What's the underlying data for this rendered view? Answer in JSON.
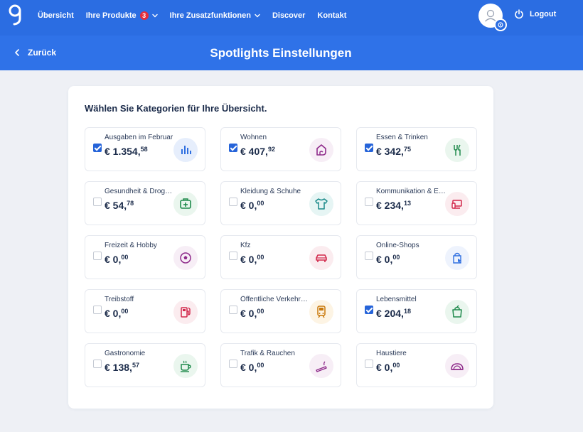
{
  "header": {
    "nav": [
      {
        "label": "Übersicht"
      },
      {
        "label": "Ihre Produkte",
        "badge": "3"
      },
      {
        "label": "Ihre Zusatzfunktionen"
      },
      {
        "label": "Discover"
      },
      {
        "label": "Kontakt"
      }
    ],
    "logout_label": "Logout"
  },
  "subheader": {
    "back_label": "Zurück",
    "title": "Spotlights Einstellungen"
  },
  "main": {
    "heading": "Wählen Sie Kategorien für Ihre Übersicht.",
    "categories": [
      {
        "title": "Ausgaben im Februar",
        "euros": "€ 1.354,",
        "cents": "58",
        "checked": true,
        "icon": "bar-chart-icon",
        "color": "#2f6fe0",
        "bg": "#e6eefc"
      },
      {
        "title": "Wohnen",
        "euros": "€ 407,",
        "cents": "92",
        "checked": true,
        "icon": "home-icon",
        "color": "#8e2a8a",
        "bg": "#f7eef6"
      },
      {
        "title": "Essen & Trinken",
        "euros": "€ 342,",
        "cents": "75",
        "checked": true,
        "icon": "cutlery-icon",
        "color": "#1f8a4c",
        "bg": "#eaf6ee"
      },
      {
        "title": "Gesundheit & Drogerie",
        "euros": "€ 54,",
        "cents": "78",
        "checked": false,
        "icon": "first-aid-icon",
        "color": "#1f8a4c",
        "bg": "#eaf6ee"
      },
      {
        "title": "Kleidung & Schuhe",
        "euros": "€ 0,",
        "cents": "00",
        "checked": false,
        "icon": "tshirt-icon",
        "color": "#1a8a8a",
        "bg": "#e6f5f4"
      },
      {
        "title": "Kommunikation & Elektronik",
        "euros": "€ 234,",
        "cents": "13",
        "checked": false,
        "icon": "devices-icon",
        "color": "#d1264a",
        "bg": "#fbecef"
      },
      {
        "title": "Freizeit & Hobby",
        "euros": "€ 0,",
        "cents": "00",
        "checked": false,
        "icon": "ball-icon",
        "color": "#8e2a8a",
        "bg": "#f7eef6"
      },
      {
        "title": "Kfz",
        "euros": "€ 0,",
        "cents": "00",
        "checked": false,
        "icon": "car-icon",
        "color": "#d1264a",
        "bg": "#fbecef"
      },
      {
        "title": "Online-Shops",
        "euros": "€ 0,",
        "cents": "00",
        "checked": false,
        "icon": "shopping-bag-cursor-icon",
        "color": "#2f6fe0",
        "bg": "#eef3fd"
      },
      {
        "title": "Treibstoff",
        "euros": "€ 0,",
        "cents": "00",
        "checked": false,
        "icon": "fuel-icon",
        "color": "#d1264a",
        "bg": "#fbecef"
      },
      {
        "title": "Öffentliche Verkehrsmittel",
        "euros": "€ 0,",
        "cents": "00",
        "checked": false,
        "icon": "train-icon",
        "color": "#c9780a",
        "bg": "#fdf4e4"
      },
      {
        "title": "Lebensmittel",
        "euros": "€ 204,",
        "cents": "18",
        "checked": true,
        "icon": "grocery-bag-icon",
        "color": "#1f8a4c",
        "bg": "#eaf6ee"
      },
      {
        "title": "Gastronomie",
        "euros": "€ 138,",
        "cents": "57",
        "checked": false,
        "icon": "coffee-cup-icon",
        "color": "#1f8a4c",
        "bg": "#eaf6ee"
      },
      {
        "title": "Trafik & Rauchen",
        "euros": "€ 0,",
        "cents": "00",
        "checked": false,
        "icon": "cigarette-icon",
        "color": "#8e2a8a",
        "bg": "#f7eef6"
      },
      {
        "title": "Haustiere",
        "euros": "€ 0,",
        "cents": "00",
        "checked": false,
        "icon": "pet-bed-icon",
        "color": "#8e2a8a",
        "bg": "#f7eef6"
      }
    ]
  },
  "colors": {
    "primary": "#2b6de2",
    "subheader": "#2f72e8",
    "badge": "#e42d3a",
    "checkbox": "#2664d9",
    "background": "#eef0f5"
  }
}
